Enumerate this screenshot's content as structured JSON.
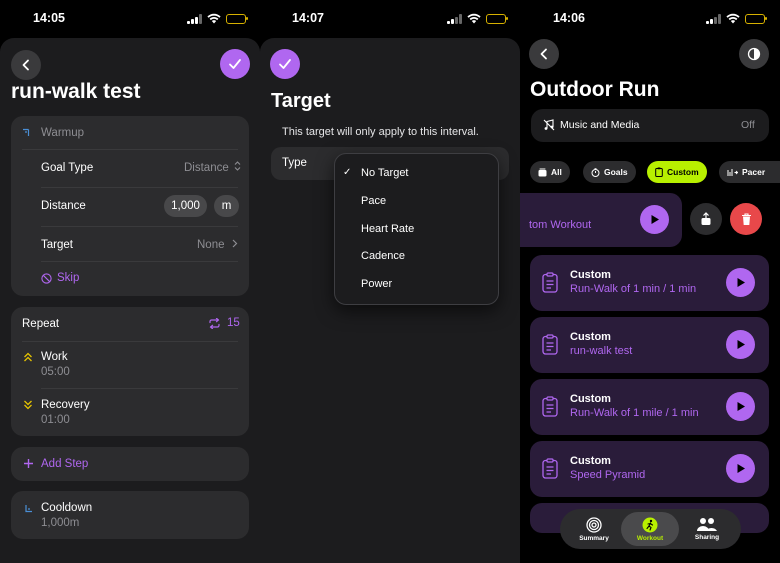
{
  "colors": {
    "accent_purple": "#b067f0",
    "accent_lime": "#b8f000",
    "card_bg": "#2c2c2e",
    "delete_red": "#e8484a"
  },
  "screen1": {
    "time": "14:05",
    "title": "run-walk test",
    "warmup": {
      "label": "Warmup",
      "goal_type_label": "Goal Type",
      "goal_type_value": "Distance",
      "distance_label": "Distance",
      "distance_value": "1,000",
      "distance_unit": "m",
      "target_label": "Target",
      "target_value": "None",
      "skip_label": "Skip"
    },
    "repeat": {
      "label": "Repeat",
      "count": "15",
      "work_label": "Work",
      "work_time": "05:00",
      "recovery_label": "Recovery",
      "recovery_time": "01:00"
    },
    "add_step_label": "Add Step",
    "cooldown": {
      "label": "Cooldown",
      "value": "1,000m"
    }
  },
  "screen2": {
    "time": "14:07",
    "title": "Target",
    "subtitle": "This target will only apply to this interval.",
    "type_label": "Type",
    "menu_options": [
      "No Target",
      "Pace",
      "Heart Rate",
      "Cadence",
      "Power"
    ],
    "selected_option": "No Target"
  },
  "screen3": {
    "time": "14:06",
    "title": "Outdoor Run",
    "music_label": "Music and Media",
    "music_value": "Off",
    "chips": [
      "All",
      "Goals",
      "Custom",
      "Pacer"
    ],
    "active_chip": "Custom",
    "swiped_workout_label": "tom Workout",
    "workouts": [
      {
        "name": "Custom",
        "sub": "Run-Walk of 1 min / 1 min"
      },
      {
        "name": "Custom",
        "sub": "run-walk test"
      },
      {
        "name": "Custom",
        "sub": "Run-Walk of 1 mile / 1 min"
      },
      {
        "name": "Custom",
        "sub": "Speed Pyramid"
      }
    ],
    "tabs": [
      "Summary",
      "Workout",
      "Sharing"
    ],
    "active_tab": "Workout"
  }
}
